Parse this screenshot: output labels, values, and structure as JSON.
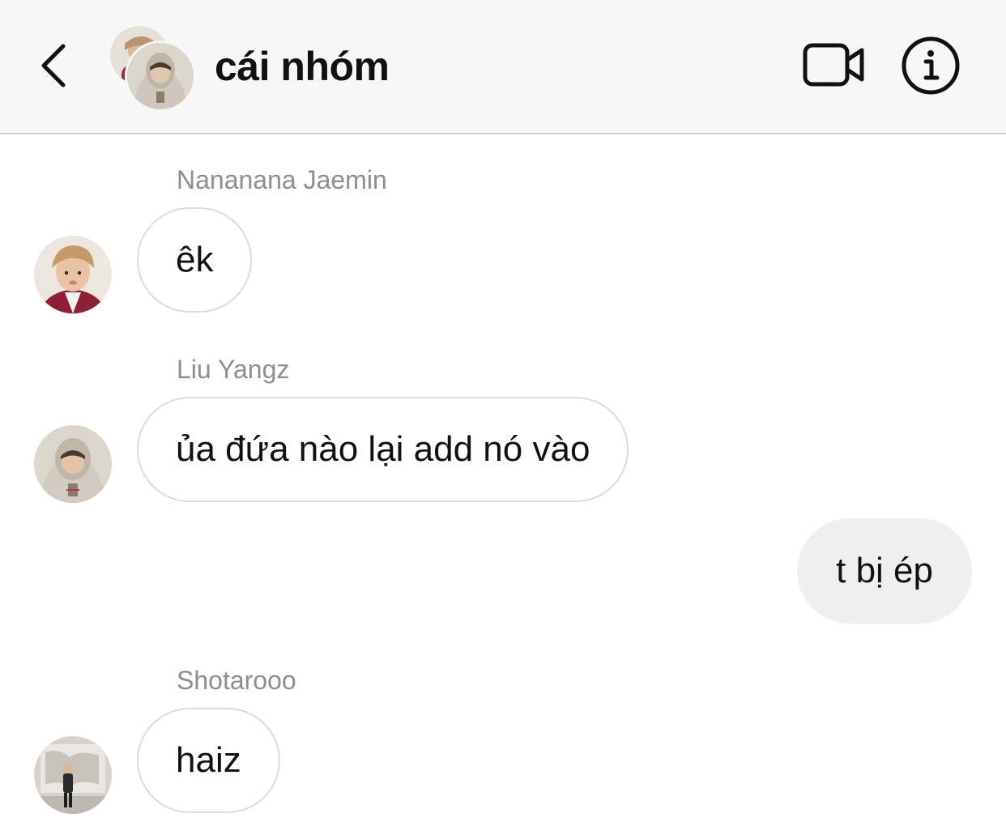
{
  "header": {
    "title": "cái nhóm",
    "back_icon": "chevron-left-icon",
    "video_icon": "video-camera-icon",
    "info_icon": "info-icon"
  },
  "messages": [
    {
      "sender": "Nananana Jaemin",
      "text": "êk",
      "direction": "incoming"
    },
    {
      "sender": "Liu Yangz",
      "text": "ủa đứa nào lại add nó vào",
      "direction": "incoming"
    },
    {
      "sender": "",
      "text": "t bị ép",
      "direction": "outgoing"
    },
    {
      "sender": "Shotarooo",
      "text": "haiz",
      "direction": "incoming"
    }
  ],
  "colors": {
    "header_bg": "#f7f7f7",
    "header_border": "#cfcfcf",
    "incoming_border": "#dbdbdb",
    "outgoing_bg": "#efefef",
    "sender_name": "#8e8e8e",
    "text": "#111111"
  }
}
